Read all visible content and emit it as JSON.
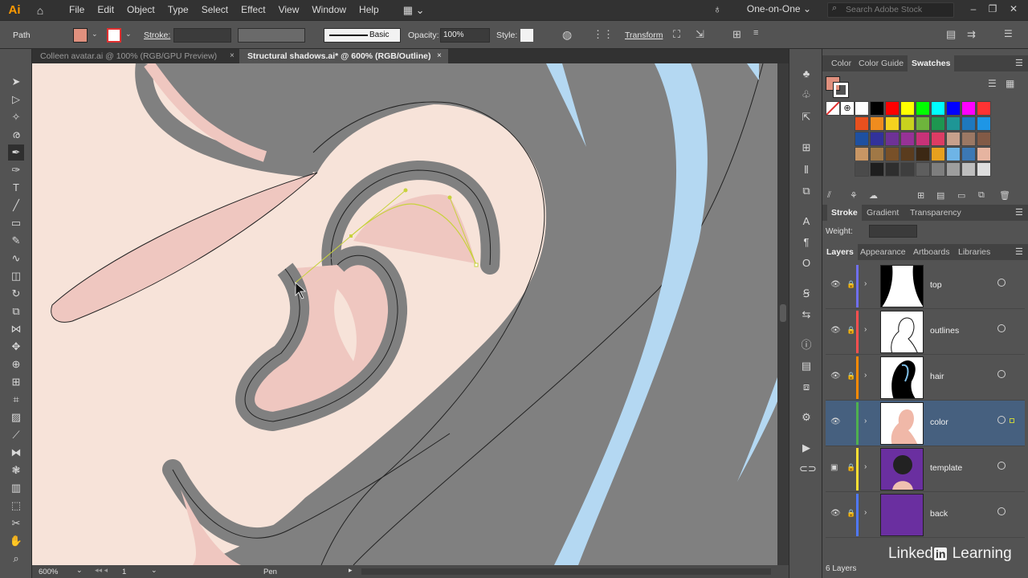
{
  "app": {
    "logo": "Ai"
  },
  "menu": [
    "File",
    "Edit",
    "Object",
    "Type",
    "Select",
    "Effect",
    "View",
    "Window",
    "Help"
  ],
  "workspace": "One-on-One",
  "search": {
    "placeholder": "Search Adobe Stock"
  },
  "control": {
    "selection_label": "Path",
    "stroke_label": "Stroke:",
    "brush_profile": "Basic",
    "opacity_label": "Opacity:",
    "opacity_value": "100%",
    "style_label": "Style:",
    "transform_label": "Transform",
    "fill_color": "#e0907e"
  },
  "tabs": [
    {
      "label": "Colleen avatar.ai @ 100% (RGB/GPU Preview)",
      "close": "×"
    },
    {
      "label": "Structural shadows.ai* @ 600% (RGB/Outline)",
      "close": "×"
    }
  ],
  "status": {
    "zoom": "600%",
    "artboard": "1",
    "tool": "Pen"
  },
  "color_panel": {
    "tabs": [
      "Color",
      "Color Guide",
      "Swatches"
    ],
    "swatches": [
      "#ffffff",
      "#000000",
      "#ff0000",
      "#ffff00",
      "#00ff00",
      "#00ffff",
      "#0000ff",
      "#ff00ff",
      "#ff3333",
      "#e8501e",
      "#f08c1e",
      "#f5d21e",
      "#c8d21e",
      "#6eb43c",
      "#1e9650",
      "#1e9696",
      "#1e78be",
      "#1e96e6",
      "#1e50a0",
      "#32329b",
      "#6e3296",
      "#963296",
      "#c83278",
      "#dc3c64",
      "#c8a08c",
      "#9b7864",
      "#825a46",
      "#c89664",
      "#a07846",
      "#785028",
      "#5a3c1e",
      "#3c2814",
      "#e6a01e",
      "#6eb4e6",
      "#3c78b4",
      "#e6b4a0",
      "#4a4a4a",
      "#1e1e1e",
      "#2e2e2e",
      "#3e3e3e",
      "#5e5e5e",
      "#7e7e7e",
      "#9e9e9e",
      "#bebebe",
      "#dedede"
    ]
  },
  "stroke_panel": {
    "tabs": [
      "Stroke",
      "Gradient",
      "Transparency"
    ],
    "weight_label": "Weight:"
  },
  "layers_panel": {
    "tabs": [
      "Layers",
      "Appearance",
      "Artboards",
      "Libraries"
    ],
    "layers": [
      {
        "name": "top",
        "color": "#6f6ff0"
      },
      {
        "name": "outlines",
        "color": "#ff4f4f"
      },
      {
        "name": "hair",
        "color": "#ff8a00"
      },
      {
        "name": "color",
        "color": "#4fb04f"
      },
      {
        "name": "template",
        "color": "#ffe033"
      },
      {
        "name": "back",
        "color": "#4f78ff"
      }
    ],
    "count": "6 Layers"
  },
  "watermark": {
    "pre": "Linked",
    "mid": "in",
    "post": "Learning"
  }
}
